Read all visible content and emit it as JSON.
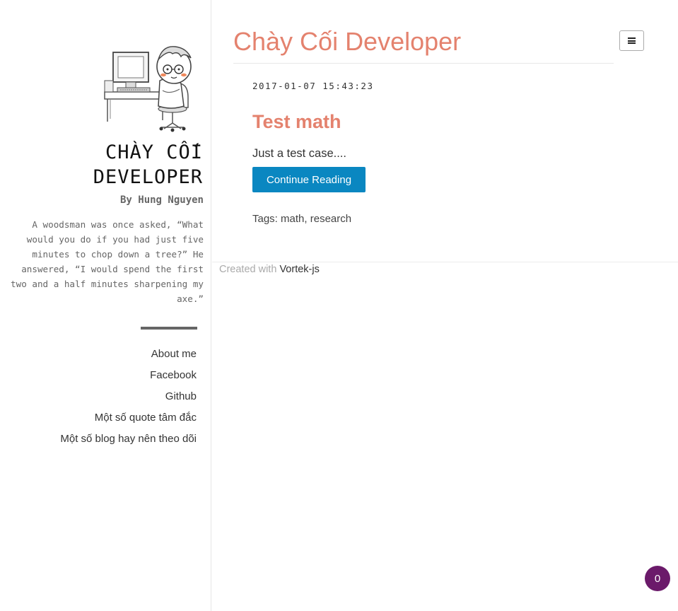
{
  "sidebar": {
    "site_name": "CHÀY CỐI DEVELOPER",
    "author": "By Hung Nguyen",
    "quote": "A woodsman was once asked, “What would you do if you had just five minutes to chop down a tree?” He answered, “I would spend the first two and a half minutes sharpening my axe.”",
    "nav": [
      {
        "label": "About me"
      },
      {
        "label": "Facebook"
      },
      {
        "label": "Github"
      },
      {
        "label": "Một số quote tâm đắc"
      },
      {
        "label": "Một số blog hay nên theo dõi"
      }
    ]
  },
  "header": {
    "title": "Chày Cối Developer",
    "menu_icon": "hamburger-icon"
  },
  "post": {
    "date": "2017-01-07 15:43:23",
    "title": "Test math",
    "excerpt": "Just a test case....",
    "continue_label": "Continue Reading",
    "tags_label": "Tags:",
    "tags": [
      "math",
      "research"
    ],
    "tag_separator": ", "
  },
  "footer": {
    "created_with": "Created with",
    "link": "Vortek-js"
  },
  "badge": {
    "count": "0"
  },
  "colors": {
    "accent": "#e4826e",
    "button": "#0a87c1",
    "badge": "#6b1a6a"
  }
}
